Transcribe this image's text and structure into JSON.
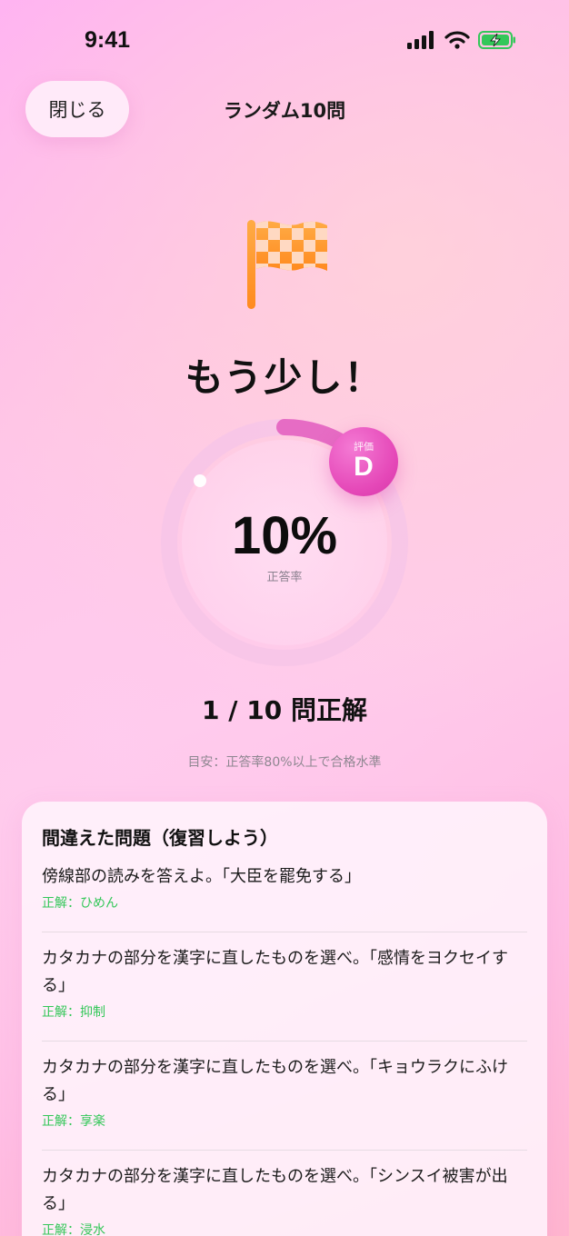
{
  "status_bar": {
    "time": "9:41"
  },
  "nav": {
    "close_label": "閉じる",
    "title": "ランダム10問"
  },
  "result": {
    "message": "もう少し！",
    "accuracy_percent": 10,
    "percent_text": "10%",
    "percent_label": "正答率",
    "grade_label": "評価",
    "grade": "D",
    "score_text": "1 / 10 問正解",
    "guide": "目安：正答率80%以上で合格水準"
  },
  "colors": {
    "accent": "#e548b8",
    "ring_track": "#f7c6e7",
    "correct": "#34c759",
    "flag": "#ff9a2e"
  },
  "review": {
    "title": "間違えた問題（復習しよう）",
    "items": [
      {
        "question": "傍線部の読みを答えよ。「大臣を罷免する」",
        "answer": "正解：ひめん"
      },
      {
        "question": "カタカナの部分を漢字に直したものを選べ。「感情をヨクセイする」",
        "answer": "正解：抑制"
      },
      {
        "question": "カタカナの部分を漢字に直したものを選べ。「キョウラクにふける」",
        "answer": "正解：享楽"
      },
      {
        "question": "カタカナの部分を漢字に直したものを選べ。「シンスイ被害が出る」",
        "answer": "正解：浸水"
      }
    ]
  },
  "icons": {
    "signal": "cellular-signal-icon",
    "wifi": "wifi-icon",
    "battery": "battery-charging-icon",
    "flag": "checkered-flag-icon"
  }
}
